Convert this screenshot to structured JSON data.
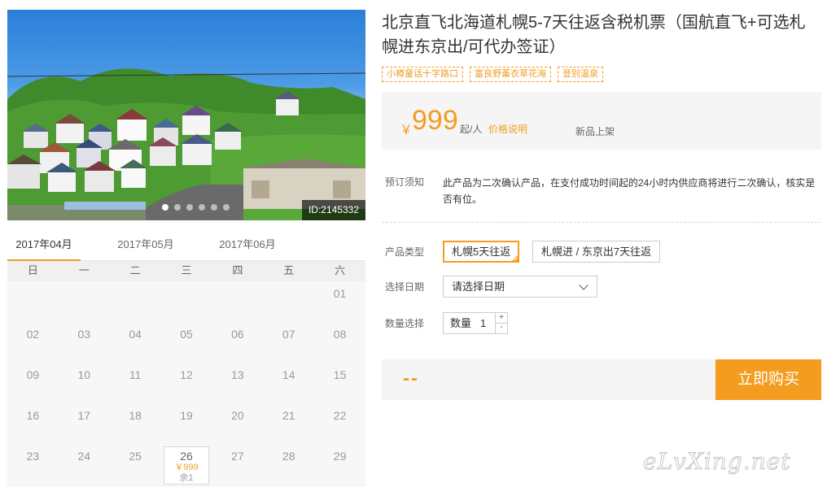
{
  "photo": {
    "id_label": "ID:2145332",
    "slide_count": 6,
    "active_slide": 0
  },
  "calendar": {
    "months": [
      "2017年04月",
      "2017年05月",
      "2017年06月"
    ],
    "active_month": 0,
    "weekdays": [
      "日",
      "一",
      "二",
      "三",
      "四",
      "五",
      "六"
    ],
    "days": [
      {
        "label": ""
      },
      {
        "label": ""
      },
      {
        "label": ""
      },
      {
        "label": ""
      },
      {
        "label": ""
      },
      {
        "label": ""
      },
      {
        "label": "01"
      },
      {
        "label": "02"
      },
      {
        "label": "03"
      },
      {
        "label": "04"
      },
      {
        "label": "05"
      },
      {
        "label": "06"
      },
      {
        "label": "07"
      },
      {
        "label": "08"
      },
      {
        "label": "09"
      },
      {
        "label": "10"
      },
      {
        "label": "11"
      },
      {
        "label": "12"
      },
      {
        "label": "13"
      },
      {
        "label": "14"
      },
      {
        "label": "15"
      },
      {
        "label": "16"
      },
      {
        "label": "17"
      },
      {
        "label": "18"
      },
      {
        "label": "19"
      },
      {
        "label": "20"
      },
      {
        "label": "21"
      },
      {
        "label": "22"
      },
      {
        "label": "23"
      },
      {
        "label": "24"
      },
      {
        "label": "25"
      },
      {
        "label": "26",
        "price": "￥999",
        "remaining": "余1"
      },
      {
        "label": "27"
      },
      {
        "label": "28"
      },
      {
        "label": "29"
      }
    ]
  },
  "product": {
    "title": "北京直飞北海道札幌5-7天往返含税机票（国航直飞+可选札幌进东京出/可代办签证）",
    "tags": [
      "小樽童话十字路口",
      "富良野薰衣草花海",
      "登别温泉"
    ]
  },
  "price": {
    "currency": "￥",
    "amount": "999",
    "unit": "起/人",
    "note_link": "价格说明",
    "status": "新品上架"
  },
  "booking_notice": {
    "label": "预订须知",
    "text": "此产品为二次确认产品，在支付成功时间起的24小时内供应商将进行二次确认，核实是否有位。"
  },
  "product_type": {
    "label": "产品类型",
    "options": [
      "札幌5天往返",
      "札幌进 / 东京出7天往返"
    ],
    "selected": 0
  },
  "date_select": {
    "label": "选择日期",
    "value": "请选择日期"
  },
  "quantity": {
    "label": "数量选择",
    "field_label": "数量",
    "value": "1",
    "plus": "+",
    "minus": "-"
  },
  "buy": {
    "total": "--",
    "button_label": "立即购买"
  },
  "watermark": {
    "text": "eLvXing.net"
  },
  "colors": {
    "accent": "#f39c1f",
    "panel_bg": "#f5f5f5",
    "calendar_bg": "#f7f7f7"
  }
}
